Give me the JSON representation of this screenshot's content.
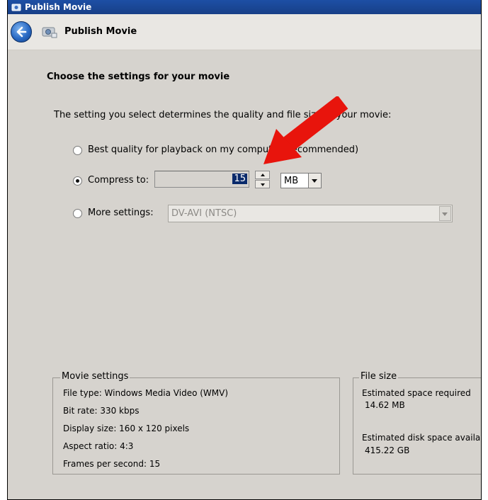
{
  "window": {
    "title": "Publish Movie"
  },
  "nav": {
    "title": "Publish Movie"
  },
  "main": {
    "heading": "Choose the settings for your movie",
    "description": "The setting you select determines the quality and file size of your movie:"
  },
  "options": {
    "best_quality": {
      "label": "Best quality for playback on my computer (recommended)",
      "selected": false
    },
    "compress": {
      "label": "Compress to:",
      "value": "15",
      "unit": "MB",
      "selected": true
    },
    "more_settings": {
      "label": "More settings:",
      "value": "DV-AVI (NTSC)",
      "selected": false,
      "enabled": false
    }
  },
  "movie_settings": {
    "legend": "Movie settings",
    "lines": [
      "File type: Windows Media Video (WMV)",
      "Bit rate: 330 kbps",
      "Display size: 160 x 120 pixels",
      "Aspect ratio: 4:3",
      "Frames per second: 15"
    ]
  },
  "file_size": {
    "legend": "File size",
    "estimated_required_label": "Estimated space required",
    "estimated_required_value": "14.62 MB",
    "estimated_available_label": "Estimated disk space available",
    "estimated_available_value": "415.22 GB"
  },
  "colors": {
    "titlebar": "#1d4fa5",
    "background": "#d6d3ce",
    "annotation_arrow": "#e8140c"
  }
}
